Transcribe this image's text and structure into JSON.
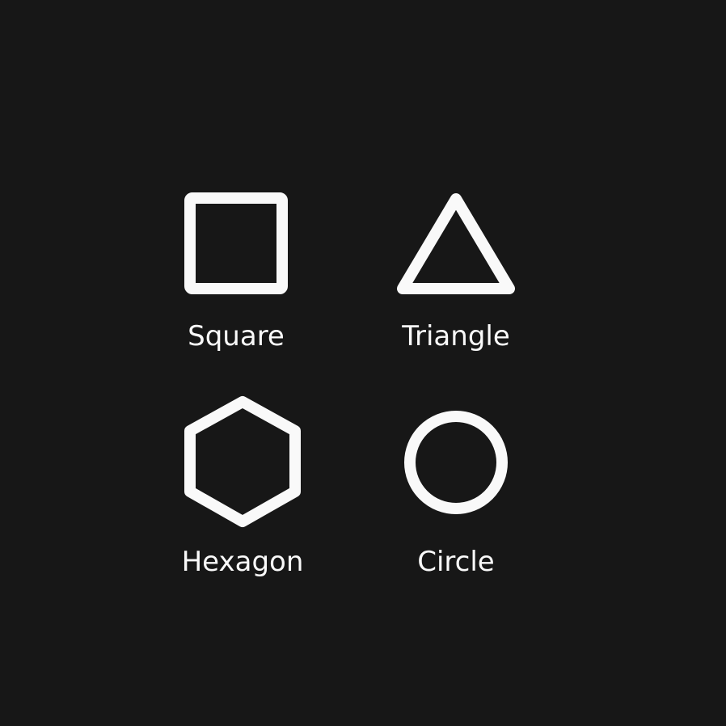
{
  "colors": {
    "background": "#171717",
    "foreground": "#f9f9f9"
  },
  "shapes": [
    {
      "label": "Square",
      "icon": "square-icon"
    },
    {
      "label": "Triangle",
      "icon": "triangle-icon"
    },
    {
      "label": "Hexagon",
      "icon": "hexagon-icon"
    },
    {
      "label": "Circle",
      "icon": "circle-icon"
    }
  ]
}
